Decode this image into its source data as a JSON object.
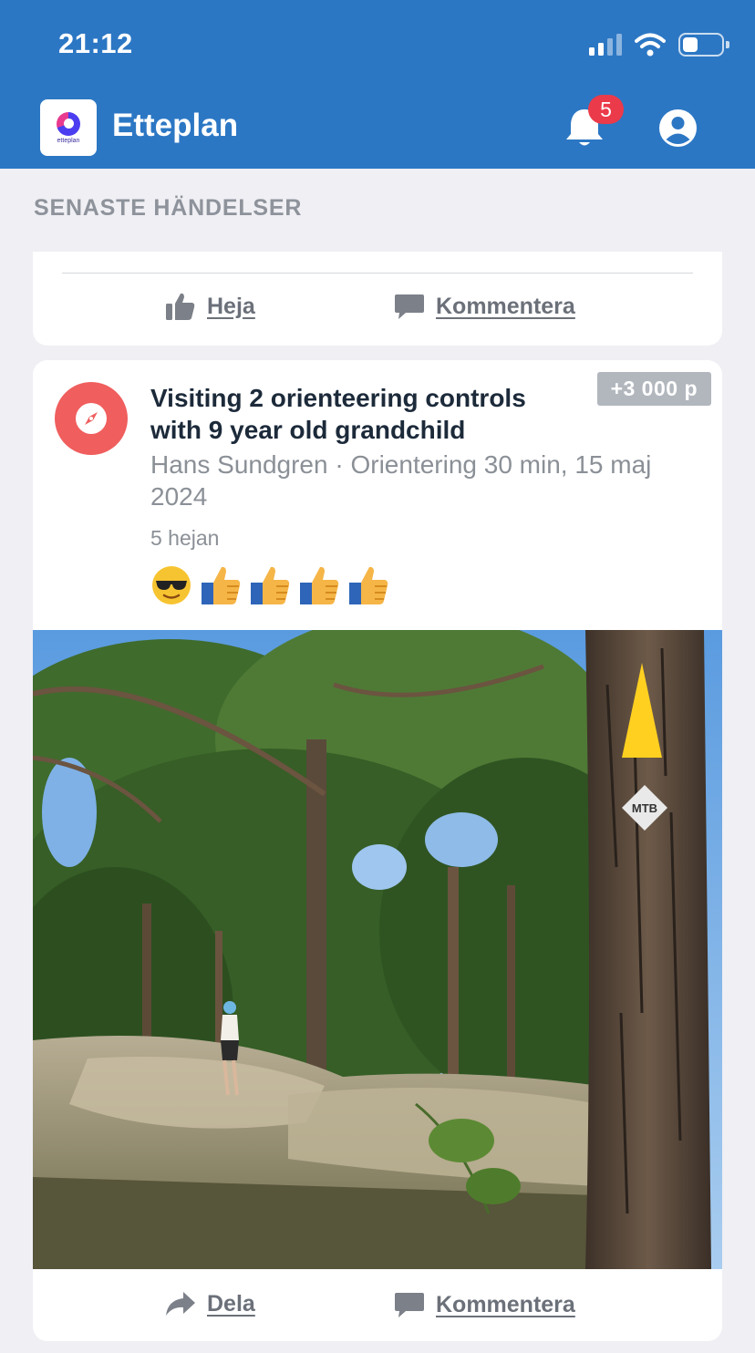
{
  "status_bar": {
    "time": "21:12"
  },
  "header": {
    "app_title": "Etteplan",
    "logo_text": "etteplan",
    "notification_count": "5"
  },
  "section": {
    "title": "SENASTE HÄNDELSER"
  },
  "previous_card": {
    "cheer_label": "Heja",
    "comment_label": "Kommentera"
  },
  "post": {
    "title": "Visiting 2 orienteering controls with 9 year old grandchild",
    "author": "Hans Sundgren",
    "separator": "·",
    "details": "Orientering 30 min, 15 maj 2024",
    "points": "+3 000 p",
    "cheer_count": "5 hejan",
    "reactions": [
      "sunglasses-emoji",
      "thumbs-up-emoji",
      "thumbs-up-emoji",
      "thumbs-up-emoji",
      "thumbs-up-emoji"
    ],
    "photo_sign_text": "MTB",
    "share_label": "Dela",
    "comment_label": "Kommentera"
  },
  "colors": {
    "header_bg": "#2c77c4",
    "badge": "#eb3a4a",
    "activity_icon_bg": "#f05e5e",
    "page_bg": "#efeff4"
  }
}
